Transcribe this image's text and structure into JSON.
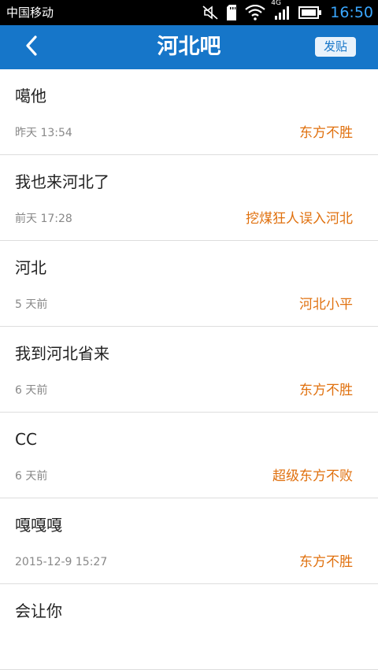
{
  "status_bar": {
    "carrier": "中国移动",
    "network": "4G",
    "time": "16:50",
    "icons": [
      "mute-icon",
      "sd-card-icon",
      "wifi-icon",
      "signal-icon",
      "battery-icon"
    ]
  },
  "header": {
    "title": "河北吧",
    "post_label": "发贴",
    "back_icon": "chevron-left-icon",
    "background": "#1676c9"
  },
  "posts": [
    {
      "title": "噶他",
      "time": "昨天 13:54",
      "author": "东方不胜"
    },
    {
      "title": "我也来河北了",
      "time": "前天 17:28",
      "author": "挖煤狂人误入河北"
    },
    {
      "title": "河北",
      "time": "5 天前",
      "author": "河北小平"
    },
    {
      "title": "我到河北省来",
      "time": "6 天前",
      "author": "东方不胜"
    },
    {
      "title": "CC",
      "time": "6 天前",
      "author": "超级东方不败"
    },
    {
      "title": "嘎嘎嘎",
      "time": "2015-12-9 15:27",
      "author": "东方不胜"
    },
    {
      "title": "会让你",
      "time": "",
      "author": ""
    }
  ],
  "colors": {
    "author": "#e0710f",
    "clock": "#3aa7ff"
  }
}
